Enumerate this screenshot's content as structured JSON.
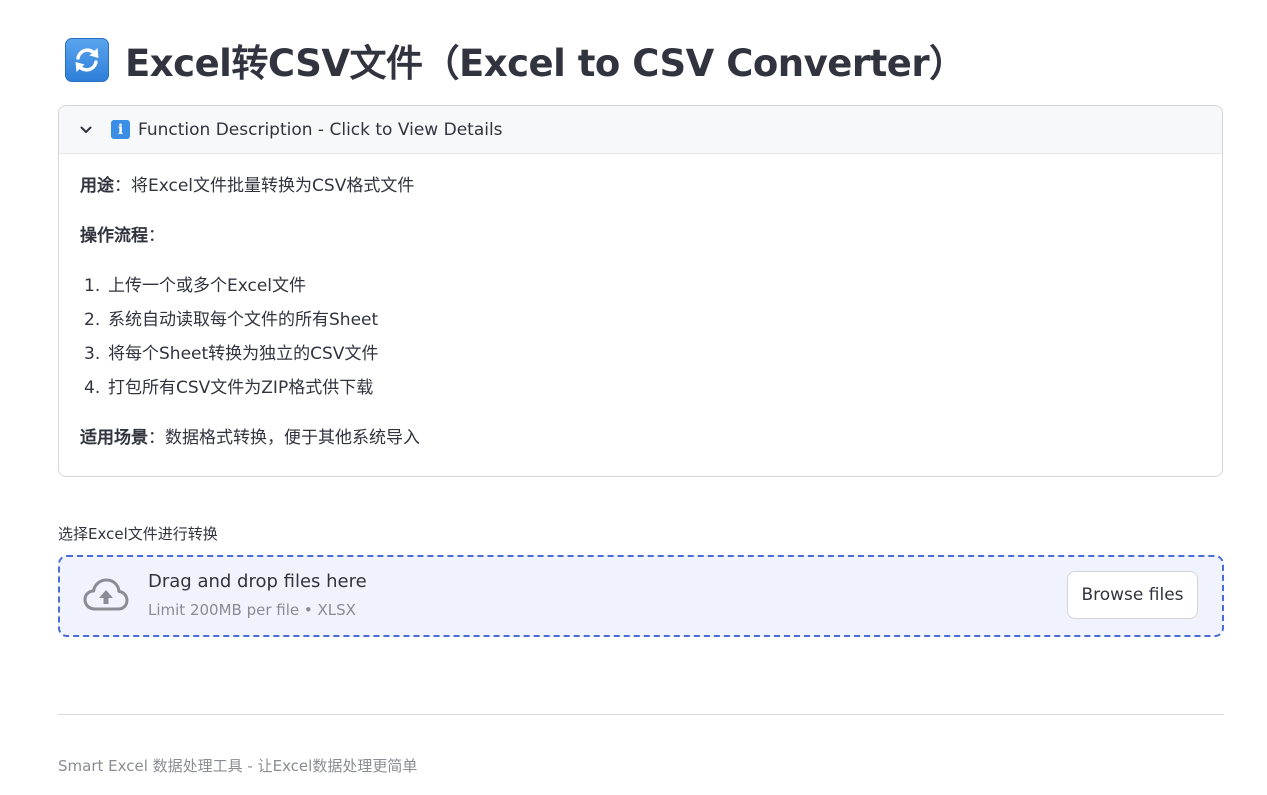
{
  "title": {
    "icon": "refresh-arrows-icon",
    "text": "Excel转CSV文件（Excel to CSV Converter）"
  },
  "expander": {
    "chevron_icon": "chevron-down-icon",
    "info_icon": "info-icon",
    "info_glyph": "i",
    "header": "Function Description - Click to View Details",
    "purpose_label": "用途",
    "purpose_text": "：将Excel文件批量转换为CSV格式文件",
    "workflow_label": "操作流程",
    "workflow_suffix": "：",
    "steps": [
      {
        "num": "1.",
        "text": "上传一个或多个Excel文件"
      },
      {
        "num": "2.",
        "text": "系统自动读取每个文件的所有Sheet"
      },
      {
        "num": "3.",
        "text": "将每个Sheet转换为独立的CSV文件"
      },
      {
        "num": "4.",
        "text": "打包所有CSV文件为ZIP格式供下载"
      }
    ],
    "scenario_label": "适用场景",
    "scenario_text": "：数据格式转换，便于其他系统导入"
  },
  "uploader": {
    "label": "选择Excel文件进行转换",
    "icon": "cloud-upload-icon",
    "drop_title": "Drag and drop files here",
    "limit_text": "Limit 200MB per file • XLSX",
    "browse_label": "Browse files"
  },
  "footer": {
    "text": "Smart Excel 数据处理工具 - 让Excel数据处理更简单"
  },
  "colors": {
    "text": "#31333f",
    "muted": "#8a8c93",
    "dropzone_border": "#4b6bd8",
    "dropzone_bg": "#f0f3fb",
    "info_blue": "#3a8ee6"
  }
}
